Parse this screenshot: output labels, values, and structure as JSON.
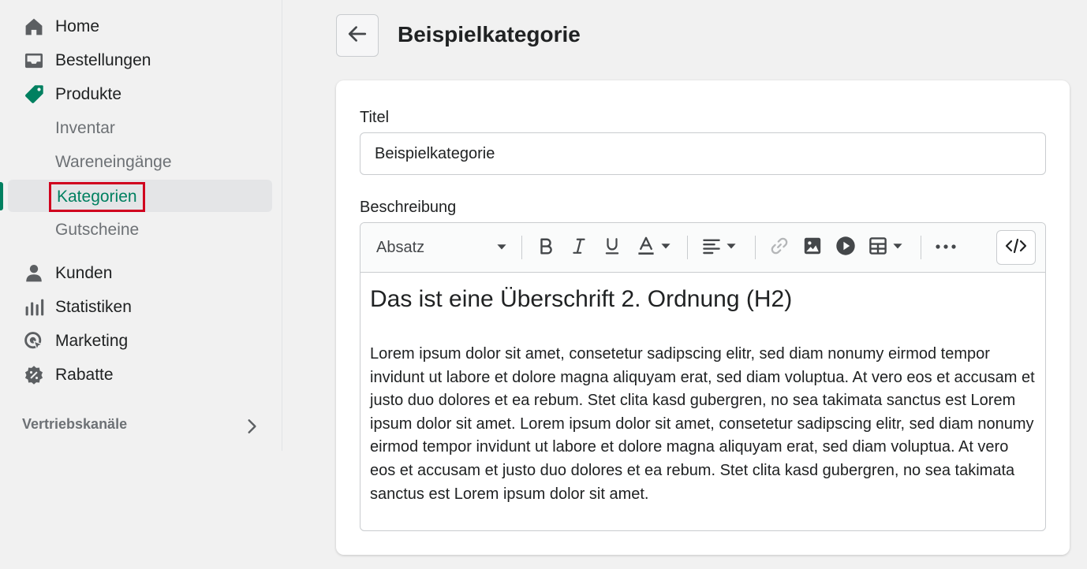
{
  "sidebar": {
    "items": [
      {
        "label": "Home",
        "icon": "home-icon"
      },
      {
        "label": "Bestellungen",
        "icon": "inbox-icon"
      },
      {
        "label": "Produkte",
        "icon": "tag-icon"
      }
    ],
    "sub_items": [
      {
        "label": "Inventar"
      },
      {
        "label": "Wareneingänge"
      },
      {
        "label": "Kategorien",
        "active": true
      },
      {
        "label": "Gutscheine"
      }
    ],
    "items2": [
      {
        "label": "Kunden",
        "icon": "person-icon"
      },
      {
        "label": "Statistiken",
        "icon": "bar-chart-icon"
      },
      {
        "label": "Marketing",
        "icon": "target-icon"
      },
      {
        "label": "Rabatte",
        "icon": "discount-icon"
      }
    ],
    "section_title": "Vertriebskanäle"
  },
  "header": {
    "title": "Beispielkategorie"
  },
  "form": {
    "title_label": "Titel",
    "title_value": "Beispielkategorie",
    "description_label": "Beschreibung"
  },
  "editor": {
    "format_select": "Absatz",
    "heading": "Das ist eine Überschrift 2. Ordnung (H2)",
    "paragraph": "Lorem ipsum dolor sit amet, consetetur sadipscing elitr, sed diam nonumy eirmod tempor invidunt ut labore et dolore magna aliquyam erat, sed diam voluptua. At vero eos et accusam et justo duo dolores et ea rebum. Stet clita kasd gubergren, no sea takimata sanctus est Lorem ipsum dolor sit amet. Lorem ipsum dolor sit amet, consetetur sadipscing elitr, sed diam nonumy eirmod tempor invidunt ut labore et dolore magna aliquyam erat, sed diam voluptua. At vero eos et accusam et justo duo dolores et ea rebum. Stet clita kasd gubergren, no sea takimata sanctus est Lorem ipsum dolor sit amet."
  },
  "colors": {
    "accent": "#008060",
    "highlight_border": "#d0001e"
  }
}
